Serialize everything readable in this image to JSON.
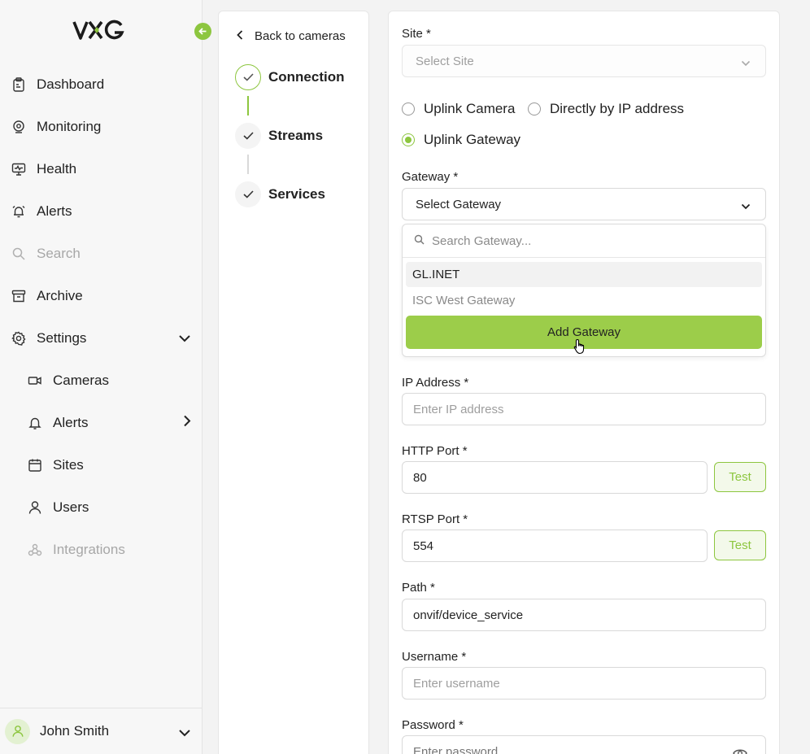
{
  "brand": {
    "logo_text": "VXG",
    "accent": "#8dc63f"
  },
  "sidebar": {
    "items": [
      {
        "label": "Dashboard",
        "icon": "clipboard-icon"
      },
      {
        "label": "Monitoring",
        "icon": "webcam-icon"
      },
      {
        "label": "Health",
        "icon": "monitor-pulse-icon"
      },
      {
        "label": "Alerts",
        "icon": "alarm-clock-icon"
      },
      {
        "label": "Search",
        "icon": "search-icon"
      },
      {
        "label": "Archive",
        "icon": "archive-icon"
      },
      {
        "label": "Settings",
        "icon": "gear-icon"
      }
    ],
    "settings_items": [
      {
        "label": "Cameras",
        "icon": "video-icon"
      },
      {
        "label": "Alerts",
        "icon": "bell-icon"
      },
      {
        "label": "Sites",
        "icon": "calendar-icon"
      },
      {
        "label": "Users",
        "icon": "user-icon"
      },
      {
        "label": "Integrations",
        "icon": "webhook-icon"
      }
    ],
    "user": {
      "name": "John Smith"
    }
  },
  "steps": {
    "back_label": "Back to cameras",
    "items": [
      {
        "label": "Connection",
        "state": "active"
      },
      {
        "label": "Streams",
        "state": "done"
      },
      {
        "label": "Services",
        "state": "done"
      }
    ]
  },
  "form": {
    "site_label": "Site *",
    "site_placeholder": "Select Site",
    "connection_options": [
      "Uplink Camera",
      "Directly by IP address",
      "Uplink Gateway"
    ],
    "connection_selected": "Uplink Gateway",
    "gateway_label": "Gateway *",
    "gateway_value": "Select Gateway",
    "gateway_search_placeholder": "Search Gateway...",
    "gateway_options": [
      "GL.INET",
      "ISC West Gateway"
    ],
    "add_gateway_label": "Add Gateway",
    "ip_label": "IP Address *",
    "ip_placeholder": "Enter IP address",
    "http_port_label": "HTTP Port *",
    "http_port_value": "80",
    "rtsp_port_label": "RTSP Port *",
    "rtsp_port_value": "554",
    "test_label": "Test",
    "path_label": "Path *",
    "path_value": "onvif/device_service",
    "username_label": "Username *",
    "username_placeholder": "Enter username",
    "password_label": "Password *",
    "password_placeholder": "Enter password"
  }
}
